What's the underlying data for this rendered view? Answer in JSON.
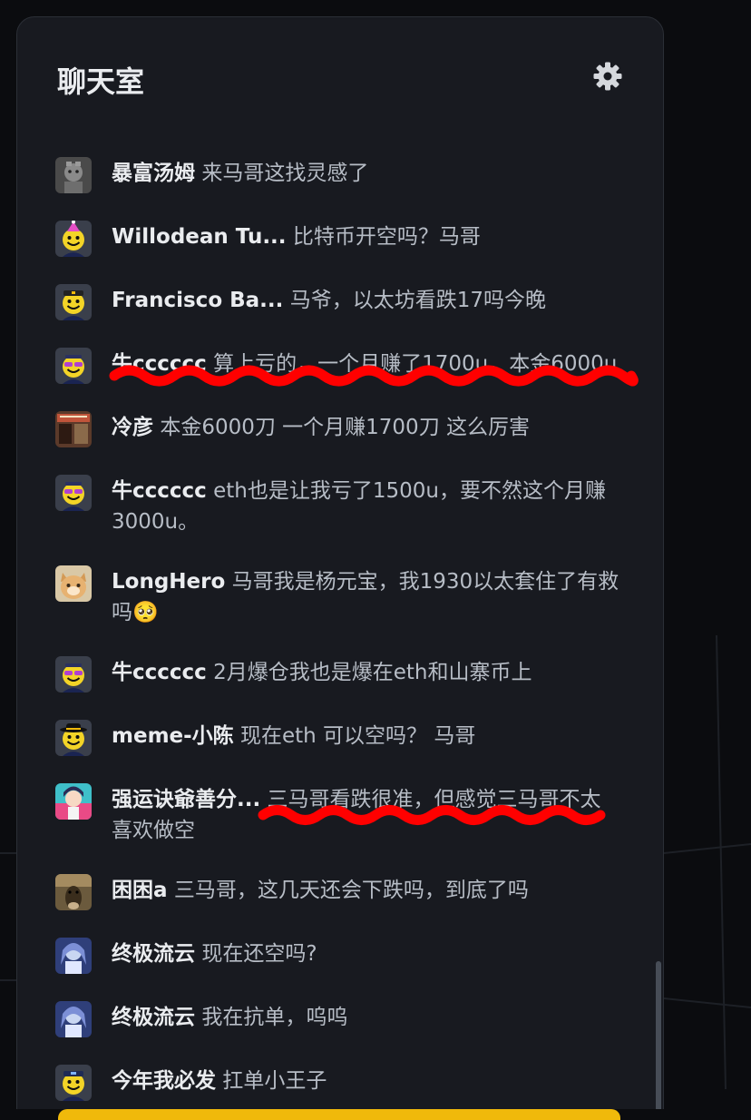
{
  "panel": {
    "title": "聊天室",
    "settings_icon": "gear-icon"
  },
  "colors": {
    "panel_bg": "#181a20",
    "username": "#eaecef",
    "message": "#b7bdc6",
    "annotation": "#ff0000",
    "accent": "#f0b90b"
  },
  "messages": [
    {
      "user": "暴富汤姆",
      "text": "来马哥这找灵感了",
      "avatar": "avatar-photo-gray"
    },
    {
      "user": "Willodean Tu...",
      "text": "比特币开空吗？马哥",
      "avatar": "avatar-smiley-party-hat"
    },
    {
      "user": "Francisco Ba...",
      "text": "马爷，以太坊看跌17吗今晚",
      "avatar": "avatar-smiley-cap"
    },
    {
      "user": "牛cccccc",
      "text": "算上亏的，一个月赚了1700u，本金6000u",
      "avatar": "avatar-smiley-sunglasses"
    },
    {
      "user": "冷彦",
      "text": "本金6000刀 一个月赚1700刀 这么厉害",
      "avatar": "avatar-photo-poster"
    },
    {
      "user": "牛cccccc",
      "text": "eth也是让我亏了1500u，要不然这个月赚3000u。",
      "avatar": "avatar-smiley-sunglasses"
    },
    {
      "user": "LongHero",
      "text": "马哥我是杨元宝，我1930以太套住了有救吗🥺",
      "avatar": "avatar-photo-cat"
    },
    {
      "user": "牛cccccc",
      "text": "2月爆仓我也是爆在eth和山寨币上",
      "avatar": "avatar-smiley-sunglasses"
    },
    {
      "user": "meme-小陈",
      "text": "现在eth 可以空吗？ 马哥",
      "avatar": "avatar-smiley-cowboy"
    },
    {
      "user": "强运诀爺善分...",
      "text": "三马哥看跌很准，但感觉三马哥不太喜欢做空",
      "avatar": "avatar-photo-anime"
    },
    {
      "user": "困困a",
      "text": "三马哥，这几天还会下跌吗，到底了吗",
      "avatar": "avatar-photo-horse"
    },
    {
      "user": "终极流云",
      "text": "现在还空吗?",
      "avatar": "avatar-photo-blue"
    },
    {
      "user": "终极流云",
      "text": "我在抗单，呜呜",
      "avatar": "avatar-photo-blue"
    },
    {
      "user": "今年我必发",
      "text": "扛单小王子",
      "avatar": "avatar-smiley-cap-blue"
    }
  ]
}
